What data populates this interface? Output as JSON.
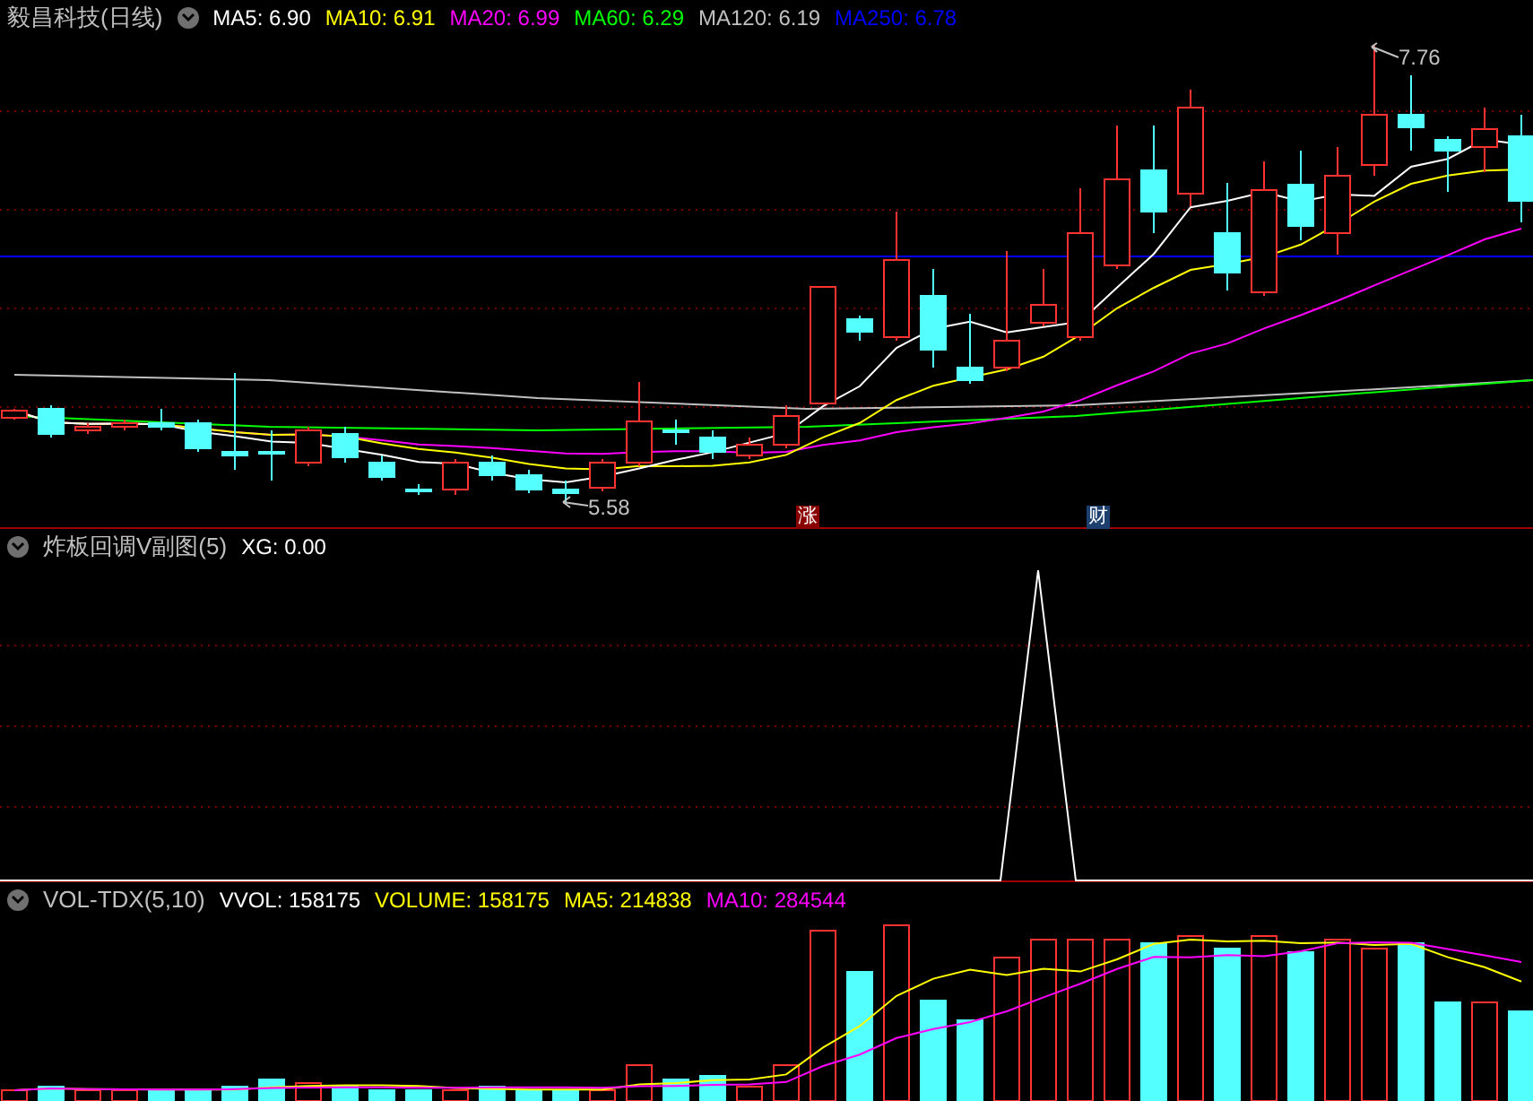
{
  "price_panel": {
    "title": "毅昌科技(日线)",
    "indicators": [
      {
        "label": "MA5: 6.90",
        "color": "#ffffff"
      },
      {
        "label": "MA10: 6.91",
        "color": "#ffff00"
      },
      {
        "label": "MA20: 6.99",
        "color": "#ff00ff"
      },
      {
        "label": "MA60: 6.29",
        "color": "#00ff00"
      },
      {
        "label": "MA120: 6.19",
        "color": "#c0c0c0"
      },
      {
        "label": "MA250: 6.78",
        "color": "#0000ff"
      }
    ],
    "high_label": "7.76",
    "low_label": "5.58",
    "event_markers": [
      {
        "text": "涨",
        "color": "#8b0000"
      },
      {
        "text": "财",
        "color": "#1c3f6e"
      }
    ]
  },
  "signal_panel": {
    "title": "炸板回调V副图(5)",
    "indicators": [
      {
        "label": "XG: 0.00",
        "color": "#ffffff"
      }
    ]
  },
  "volume_panel": {
    "title": "VOL-TDX(5,10)",
    "indicators": [
      {
        "label": "VVOL: 158175",
        "color": "#ffffff"
      },
      {
        "label": "VOLUME: 158175",
        "color": "#ffff00"
      },
      {
        "label": "MA5: 214838",
        "color": "#ffff00"
      },
      {
        "label": "MA10: 284544",
        "color": "#ff00ff"
      }
    ]
  }
}
